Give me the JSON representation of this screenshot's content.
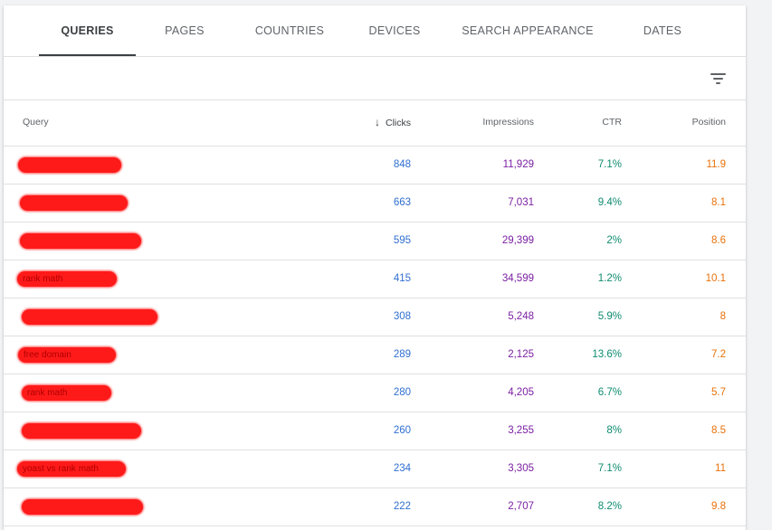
{
  "tabs": [
    {
      "label": "QUERIES"
    },
    {
      "label": "PAGES"
    },
    {
      "label": "COUNTRIES"
    },
    {
      "label": "DEVICES"
    },
    {
      "label": "SEARCH APPEARANCE"
    },
    {
      "label": "DATES"
    }
  ],
  "active_tab": "QUERIES",
  "toolbar": {
    "filter_icon": "filter-list-icon"
  },
  "table": {
    "headers": {
      "query": "Query",
      "clicks": "Clicks",
      "impressions": "Impressions",
      "ctr": "CTR",
      "position": "Position"
    },
    "sort_icon": "arrow-down-icon",
    "colors": {
      "clicks": "#2f6fd0",
      "impressions": "#7b1fa2",
      "ctr": "#0f8b6f",
      "position": "#e8710a",
      "redaction": "#ff1a1a"
    },
    "rows": [
      {
        "query": "",
        "clicks": "848",
        "impressions": "11,929",
        "ctr": "7.1%",
        "position": "11.9"
      },
      {
        "query": "",
        "clicks": "663",
        "impressions": "7,031",
        "ctr": "9.4%",
        "position": "8.1"
      },
      {
        "query": "",
        "clicks": "595",
        "impressions": "29,399",
        "ctr": "2%",
        "position": "8.6"
      },
      {
        "query": "rank math",
        "clicks": "415",
        "impressions": "34,599",
        "ctr": "1.2%",
        "position": "10.1"
      },
      {
        "query": "",
        "clicks": "308",
        "impressions": "5,248",
        "ctr": "5.9%",
        "position": "8"
      },
      {
        "query": "free domain",
        "clicks": "289",
        "impressions": "2,125",
        "ctr": "13.6%",
        "position": "7.2"
      },
      {
        "query": "rank math",
        "clicks": "280",
        "impressions": "4,205",
        "ctr": "6.7%",
        "position": "5.7"
      },
      {
        "query": "",
        "clicks": "260",
        "impressions": "3,255",
        "ctr": "8%",
        "position": "8.5"
      },
      {
        "query": "yoast vs rank math",
        "clicks": "234",
        "impressions": "3,305",
        "ctr": "7.1%",
        "position": "11"
      },
      {
        "query": "",
        "clicks": "222",
        "impressions": "2,707",
        "ctr": "8.2%",
        "position": "9.8"
      }
    ]
  }
}
